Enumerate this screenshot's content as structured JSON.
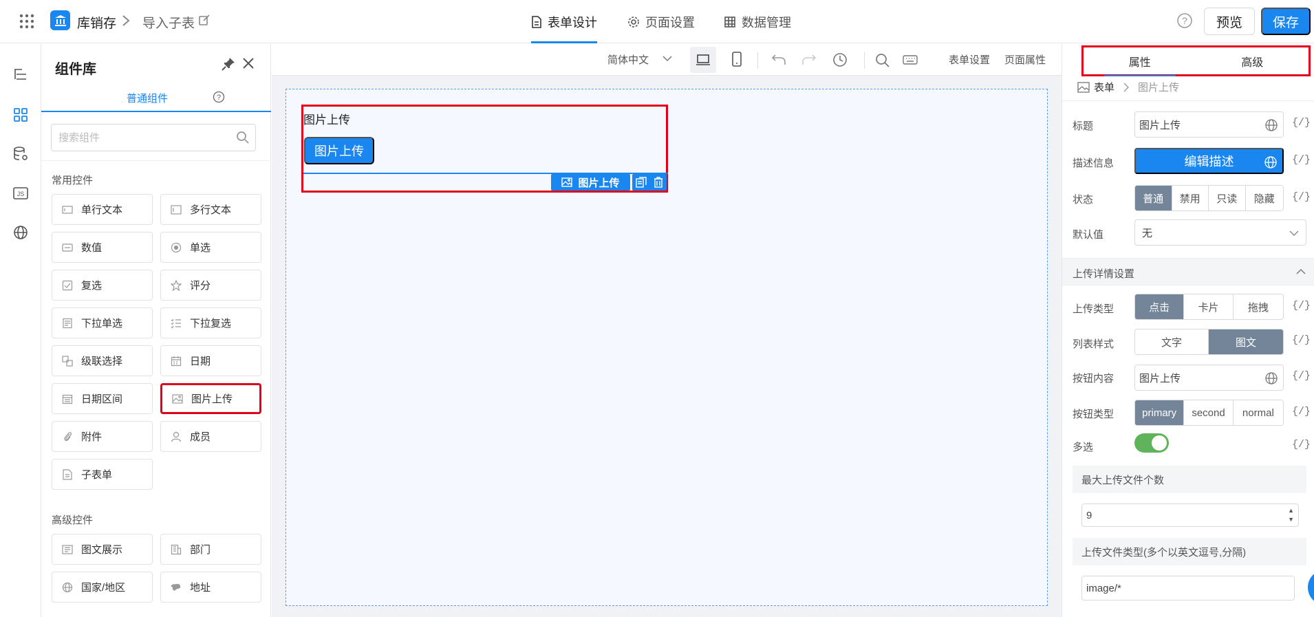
{
  "header": {
    "app_name": "库销存",
    "sub_page": "导入子表",
    "tabs": [
      {
        "label": "表单设计",
        "active": true
      },
      {
        "label": "页面设置",
        "active": false
      },
      {
        "label": "数据管理",
        "active": false
      }
    ],
    "preview_label": "预览",
    "save_label": "保存"
  },
  "library": {
    "title": "组件库",
    "tab_label": "普通组件",
    "search_placeholder": "搜索组件",
    "common_section": "常用控件",
    "common_items": [
      {
        "label": "单行文本",
        "icon": "text-input-icon"
      },
      {
        "label": "多行文本",
        "icon": "textarea-icon"
      },
      {
        "label": "数值",
        "icon": "number-icon"
      },
      {
        "label": "单选",
        "icon": "radio-icon"
      },
      {
        "label": "复选",
        "icon": "checkbox-icon"
      },
      {
        "label": "评分",
        "icon": "star-icon"
      },
      {
        "label": "下拉单选",
        "icon": "dropdown-single-icon"
      },
      {
        "label": "下拉复选",
        "icon": "dropdown-multi-icon"
      },
      {
        "label": "级联选择",
        "icon": "cascade-icon"
      },
      {
        "label": "日期",
        "icon": "calendar-icon"
      },
      {
        "label": "日期区间",
        "icon": "date-range-icon"
      },
      {
        "label": "图片上传",
        "icon": "image-icon"
      },
      {
        "label": "附件",
        "icon": "attachment-icon"
      },
      {
        "label": "成员",
        "icon": "member-icon"
      },
      {
        "label": "子表单",
        "icon": "subform-icon"
      }
    ],
    "advanced_section": "高级控件",
    "advanced_items": [
      {
        "label": "图文展示",
        "icon": "richtext-icon"
      },
      {
        "label": "部门",
        "icon": "department-icon"
      },
      {
        "label": "国家/地区",
        "icon": "globe-icon"
      },
      {
        "label": "地址",
        "icon": "map-icon"
      }
    ]
  },
  "canvas_toolbar": {
    "language": "简体中文",
    "form_settings": "表单设置",
    "page_props": "页面属性"
  },
  "canvas": {
    "field_label": "图片上传",
    "upload_button": "图片上传",
    "selected_tag": "图片上传"
  },
  "props": {
    "tabs": [
      {
        "label": "属性",
        "active": true
      },
      {
        "label": "高级",
        "active": false
      }
    ],
    "breadcrumb_root": "表单",
    "breadcrumb_current": "图片上传",
    "fx": "{/}",
    "title_label": "标题",
    "title_value": "图片上传",
    "desc_label": "描述信息",
    "desc_button": "编辑描述",
    "state_label": "状态",
    "state_options": [
      "普通",
      "禁用",
      "只读",
      "隐藏"
    ],
    "default_label": "默认值",
    "default_value": "无",
    "upload_section": "上传详情设置",
    "upload_type_label": "上传类型",
    "upload_type_options": [
      "点击",
      "卡片",
      "拖拽"
    ],
    "list_style_label": "列表样式",
    "list_style_options": [
      "文字",
      "图文"
    ],
    "button_content_label": "按钮内容",
    "button_content_value": "图片上传",
    "button_type_label": "按钮类型",
    "button_type_options": [
      "primary",
      "second",
      "normal"
    ],
    "multi_label": "多选",
    "max_files_label": "最大上传文件个数",
    "max_files_value": "9",
    "file_types_label": "上传文件类型(多个以英文逗号,分隔)",
    "file_types_value": "image/*"
  }
}
